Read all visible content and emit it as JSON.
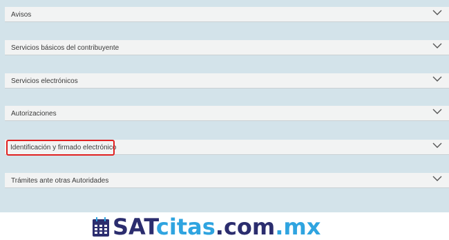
{
  "accordion": {
    "items": [
      {
        "label": "Avisos"
      },
      {
        "label": "Servicios básicos del contribuyente"
      },
      {
        "label": "Servicios electrónicos"
      },
      {
        "label": "Autorizaciones"
      },
      {
        "label": "Identificación y firmado electrónico"
      },
      {
        "label": "Trámites ante otras Autoridades"
      }
    ],
    "chevron_icon": "chevron-down-icon",
    "highlighted_index": 4,
    "highlight_color": "#e02020"
  },
  "branding": {
    "part1": "SAT",
    "part2": "citas",
    "part3": ".com",
    "part4": ".mx",
    "icon": "calendar-icon",
    "color_dark": "#2b2d6e",
    "color_light": "#2fa4e0"
  }
}
